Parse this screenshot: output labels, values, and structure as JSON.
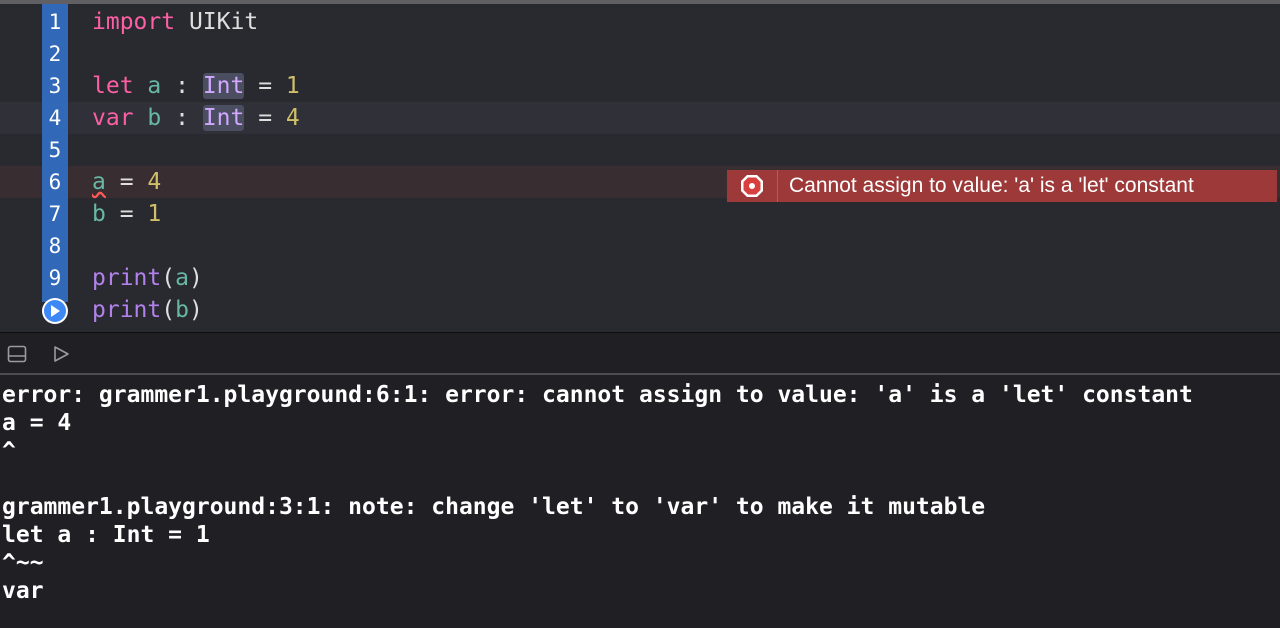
{
  "editor": {
    "line_numbers": [
      "1",
      "2",
      "3",
      "4",
      "5",
      "6",
      "7",
      "8",
      "9"
    ],
    "lines": [
      {
        "tokens": [
          {
            "t": "import",
            "c": "kw"
          },
          {
            "t": " UIKit",
            "c": ""
          }
        ]
      },
      {
        "tokens": []
      },
      {
        "tokens": [
          {
            "t": "let",
            "c": "kw"
          },
          {
            "t": " ",
            "c": ""
          },
          {
            "t": "a",
            "c": "var"
          },
          {
            "t": " : ",
            "c": ""
          },
          {
            "t": "Int",
            "c": "type-hl"
          },
          {
            "t": " = ",
            "c": ""
          },
          {
            "t": "1",
            "c": "num"
          }
        ]
      },
      {
        "tokens": [
          {
            "t": "var",
            "c": "kw"
          },
          {
            "t": " ",
            "c": ""
          },
          {
            "t": "b",
            "c": "var"
          },
          {
            "t": " : ",
            "c": ""
          },
          {
            "t": "Int",
            "c": "type-hl"
          },
          {
            "t": " = ",
            "c": ""
          },
          {
            "t": "4",
            "c": "num"
          }
        ]
      },
      {
        "tokens": []
      },
      {
        "tokens": [
          {
            "t": "a",
            "c": "var err-underline"
          },
          {
            "t": " = ",
            "c": ""
          },
          {
            "t": "4",
            "c": "num"
          }
        ]
      },
      {
        "tokens": [
          {
            "t": "b",
            "c": "var"
          },
          {
            "t": " = ",
            "c": ""
          },
          {
            "t": "1",
            "c": "num"
          }
        ]
      },
      {
        "tokens": []
      },
      {
        "tokens": [
          {
            "t": "print",
            "c": "fn"
          },
          {
            "t": "(",
            "c": ""
          },
          {
            "t": "a",
            "c": "var"
          },
          {
            "t": ")",
            "c": ""
          }
        ]
      },
      {
        "tokens": [
          {
            "t": "print",
            "c": "fn"
          },
          {
            "t": "(",
            "c": ""
          },
          {
            "t": "b",
            "c": "var"
          },
          {
            "t": ")",
            "c": ""
          }
        ]
      }
    ],
    "current_line_index": 3,
    "error_line_index": 5,
    "error_message": "Cannot assign to value: 'a' is a 'let' constant"
  },
  "toolbar": {
    "icons": [
      "hide-debug-area-icon",
      "run-playground-icon"
    ]
  },
  "console": {
    "lines": [
      "error: grammer1.playground:6:1: error: cannot assign to value: 'a' is a 'let' constant",
      "a = 4",
      "^",
      "",
      "grammer1.playground:3:1: note: change 'let' to 'var' to make it mutable",
      "let a : Int = 1",
      "^~~",
      "var"
    ]
  },
  "colors": {
    "editor_bg": "#292a30",
    "gutter_accent": "#3168b8",
    "keyword": "#fc5fa3",
    "identifier": "#67b7a4",
    "number": "#d0bf69",
    "function": "#b281eb",
    "error_banner": "#9d3a39",
    "console_bg": "#1f1f24"
  }
}
